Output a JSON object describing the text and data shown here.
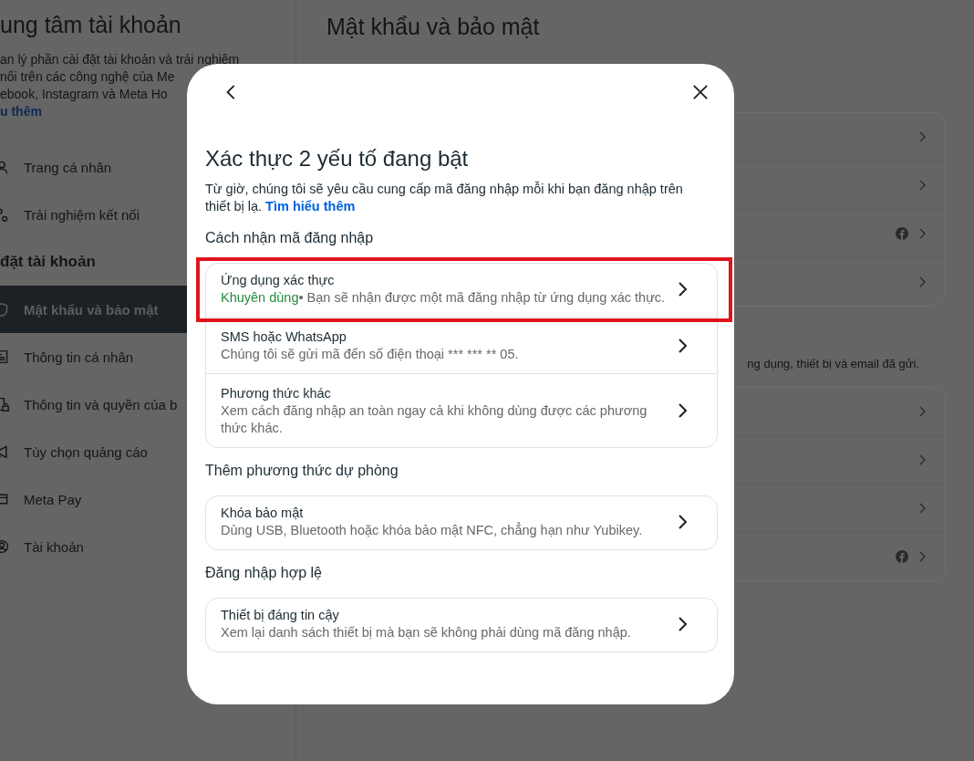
{
  "sidebar": {
    "title": "ung tâm tài khoản",
    "description_lines": [
      "an lý phần cài đặt tài khoản và trải nghiệm",
      "nối trên các công nghệ của Me",
      "ebook, Instagram và Meta Ho"
    ],
    "learn_more": "u thêm",
    "items": [
      {
        "label": "Trang cá nhân",
        "selected": false
      },
      {
        "label": "Trải nghiệm kết nối",
        "selected": false
      }
    ],
    "section_header": "đặt tài khoản",
    "settings_items": [
      {
        "label": "Mật khẩu và bảo mật",
        "selected": true
      },
      {
        "label": "Thông tin cá nhân",
        "selected": false
      },
      {
        "label": "Thông tin và quyền của b",
        "selected": false
      },
      {
        "label": "Tùy chọn quảng cáo",
        "selected": false
      },
      {
        "label": "Meta Pay",
        "selected": false
      },
      {
        "label": "Tài khoản",
        "selected": false
      }
    ]
  },
  "main": {
    "title": "Mật khẩu và bảo mật",
    "cards": [
      {
        "rows": [
          {
            "facebook_badge": false
          },
          {
            "facebook_badge": false
          },
          {
            "facebook_badge": true
          },
          {
            "facebook_badge": false
          }
        ]
      },
      {
        "caption": "ng dụng, thiết bị và email đã gửi.",
        "rows": [
          {
            "facebook_badge": false
          },
          {
            "facebook_badge": false
          },
          {
            "facebook_badge": false
          },
          {
            "facebook_badge": true
          }
        ]
      }
    ]
  },
  "dialog": {
    "title": "Xác thực 2 yếu tố đang bật",
    "description": "Từ giờ, chúng tôi sẽ yêu cầu cung cấp mã đăng nhập mỗi khi bạn đăng nhập trên thiết bị lạ.",
    "learn_more": "Tìm hiểu thêm",
    "sections": [
      {
        "heading": "Cách nhận mã đăng nhập",
        "options": [
          {
            "title": "Ứng dụng xác thực",
            "tag": "Khuyên dùng",
            "subtitle": "• Bạn sẽ nhận được một mã đăng nhập từ ứng dụng xác thực.",
            "highlighted": true
          },
          {
            "title": "SMS hoặc WhatsApp",
            "subtitle": "Chúng tôi sẽ gửi mã đến số điện thoại *** *** ** 05.",
            "highlighted": false
          },
          {
            "title": "Phương thức khác",
            "subtitle": "Xem cách đăng nhập an toàn ngay cả khi không dùng được các phương thức khác.",
            "highlighted": false
          }
        ]
      },
      {
        "heading": "Thêm phương thức dự phòng",
        "options": [
          {
            "title": "Khóa bảo mật",
            "subtitle": "Dùng USB, Bluetooth hoặc khóa bảo mật NFC, chẳng hạn như Yubikey.",
            "highlighted": false
          }
        ]
      },
      {
        "heading": "Đăng nhập hợp lệ",
        "options": [
          {
            "title": "Thiết bị đáng tin cậy",
            "subtitle": "Xem lại danh sách thiết bị mà bạn sẽ không phải dùng mã đăng nhập.",
            "highlighted": false
          }
        ]
      }
    ]
  }
}
